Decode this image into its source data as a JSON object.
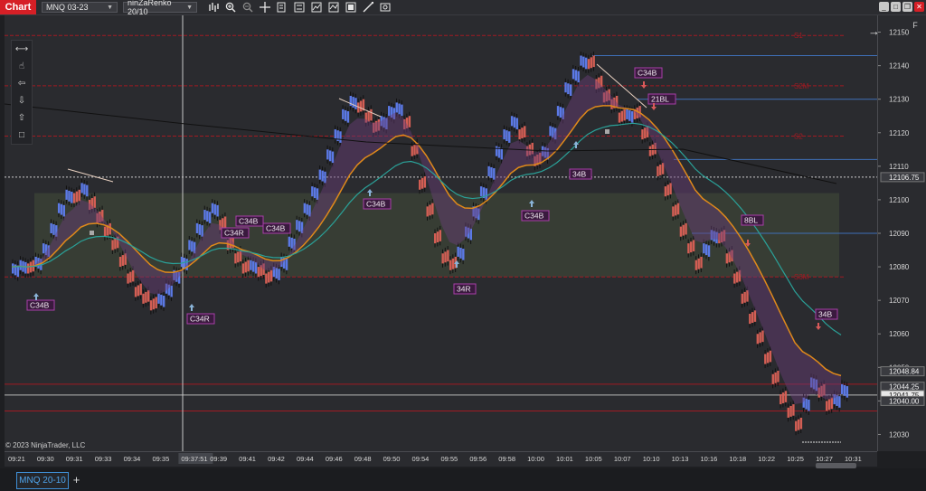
{
  "toolbar": {
    "chart_tab": "Chart",
    "instrument": "MNQ 03-23",
    "period": "ninZaRenko 20/10",
    "icons": [
      "bars-type-icon",
      "magnify-plus-icon",
      "magnify-minus-icon",
      "crosshair-icon",
      "template-icon",
      "properties-icon",
      "strategy-icon",
      "indicator-icon",
      "data-box-icon",
      "drawing-icon",
      "snapshot-icon"
    ]
  },
  "window": {
    "buttons": [
      "minimize",
      "maximize",
      "restore",
      "close"
    ]
  },
  "right_tools": {
    "f_button": "F"
  },
  "copyright": "© 2023 NinjaTrader, LLC",
  "bottom_tab": {
    "label": "MNQ 20-10",
    "add": "+"
  },
  "colors": {
    "bg": "#2a2b2f",
    "bull": "#5b79e6",
    "bear": "#d35e54",
    "orange": "#e08a1a",
    "teal": "#2aa198",
    "level": "#a11a22",
    "label": "#a83fa8"
  },
  "chart_data": {
    "type": "candlestick",
    "y_ticks": [
      12150,
      12140,
      12130,
      12120,
      12110,
      12100,
      12090,
      12080,
      12070,
      12060,
      12050,
      12040,
      12030
    ],
    "y_range": [
      12025,
      12155
    ],
    "price_tags": [
      {
        "value": "12106.75",
        "highlight": false
      },
      {
        "value": "12048.84",
        "highlight": false
      },
      {
        "value": "12044.25",
        "highlight": false
      },
      {
        "value": "12041.75",
        "highlight": true
      },
      {
        "value": "12040.00",
        "highlight": false
      }
    ],
    "x_labels": [
      "09:21",
      "09:30",
      "09:31",
      "09:33",
      "09:34",
      "09:35",
      "09:37:51",
      "09:39",
      "09:41",
      "09:42",
      "09:44",
      "09:46",
      "09:48",
      "09:50",
      "09:54",
      "09:55",
      "09:56",
      "09:58",
      "10:00",
      "10:01",
      "10:05",
      "10:07",
      "10:10",
      "10:13",
      "10:16",
      "10:18",
      "10:22",
      "10:25",
      "10:27",
      "10:31"
    ],
    "level_labels": [
      "S1",
      "S2M",
      "S2",
      "S3M"
    ],
    "signal_labels": [
      "C34B",
      "C34R",
      "C34B",
      "C34R",
      "C34B",
      "C34B",
      "34R",
      "C34B",
      "34B",
      "C34B",
      "21BL",
      "8BL",
      "34B"
    ],
    "path": [
      12080,
      12081,
      12079,
      12082,
      12086,
      12092,
      12098,
      12102,
      12100,
      12104,
      12098,
      12094,
      12090,
      12086,
      12081,
      12076,
      12072,
      12070,
      12068,
      12071,
      12074,
      12078,
      12082,
      12087,
      12092,
      12096,
      12098,
      12092,
      12086,
      12082,
      12079,
      12081,
      12078,
      12076,
      12079,
      12082,
      12088,
      12093,
      12098,
      12103,
      12108,
      12114,
      12120,
      12126,
      12130,
      12127,
      12124,
      12121,
      12124,
      12127,
      12128,
      12122,
      12114,
      12104,
      12096,
      12088,
      12082,
      12080,
      12085,
      12091,
      12097,
      12103,
      12109,
      12115,
      12120,
      12124,
      12119,
      12114,
      12111,
      12115,
      12121,
      12127,
      12134,
      12138,
      12142,
      12140,
      12134,
      12130,
      12128,
      12124,
      12126,
      12125,
      12119,
      12114,
      12108,
      12102,
      12096,
      12090,
      12085,
      12080,
      12086,
      12090,
      12088,
      12082,
      12076,
      12070,
      12064,
      12058,
      12052,
      12046,
      12040,
      12036,
      12032,
      12040,
      12046,
      12042,
      12038,
      12041,
      12044
    ]
  }
}
